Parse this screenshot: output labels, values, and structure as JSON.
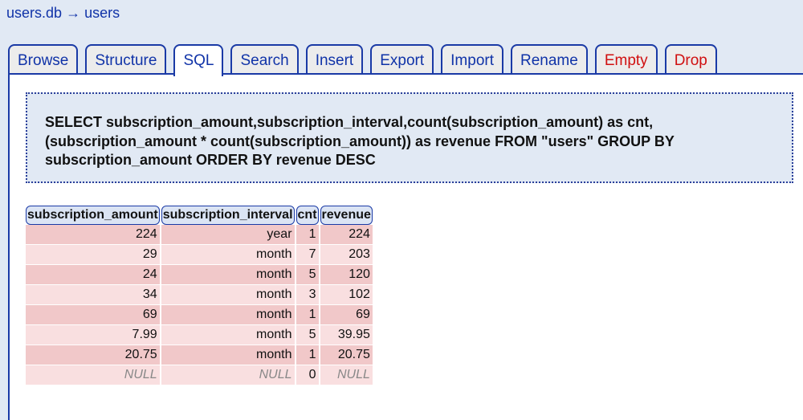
{
  "breadcrumb": {
    "database": "users.db",
    "arrow": "→",
    "table": "users"
  },
  "tabs": [
    {
      "label": "Browse",
      "active": false,
      "danger": false
    },
    {
      "label": "Structure",
      "active": false,
      "danger": false
    },
    {
      "label": "SQL",
      "active": true,
      "danger": false
    },
    {
      "label": "Search",
      "active": false,
      "danger": false
    },
    {
      "label": "Insert",
      "active": false,
      "danger": false
    },
    {
      "label": "Export",
      "active": false,
      "danger": false
    },
    {
      "label": "Import",
      "active": false,
      "danger": false
    },
    {
      "label": "Rename",
      "active": false,
      "danger": false
    },
    {
      "label": "Empty",
      "active": false,
      "danger": true
    },
    {
      "label": "Drop",
      "active": false,
      "danger": true
    }
  ],
  "query": "SELECT subscription_amount,subscription_interval,count(subscription_amount) as cnt, (subscription_amount * count(subscription_amount)) as revenue FROM \"users\" GROUP BY subscription_amount ORDER BY revenue DESC",
  "result": {
    "columns": [
      "subscription_amount",
      "subscription_interval",
      "cnt",
      "revenue"
    ],
    "rows": [
      [
        "224",
        "year",
        "1",
        "224"
      ],
      [
        "29",
        "month",
        "7",
        "203"
      ],
      [
        "24",
        "month",
        "5",
        "120"
      ],
      [
        "34",
        "month",
        "3",
        "102"
      ],
      [
        "69",
        "month",
        "1",
        "69"
      ],
      [
        "7.99",
        "month",
        "5",
        "39.95"
      ],
      [
        "20.75",
        "month",
        "1",
        "20.75"
      ],
      [
        "NULL",
        "NULL",
        "0",
        "NULL"
      ]
    ]
  }
}
